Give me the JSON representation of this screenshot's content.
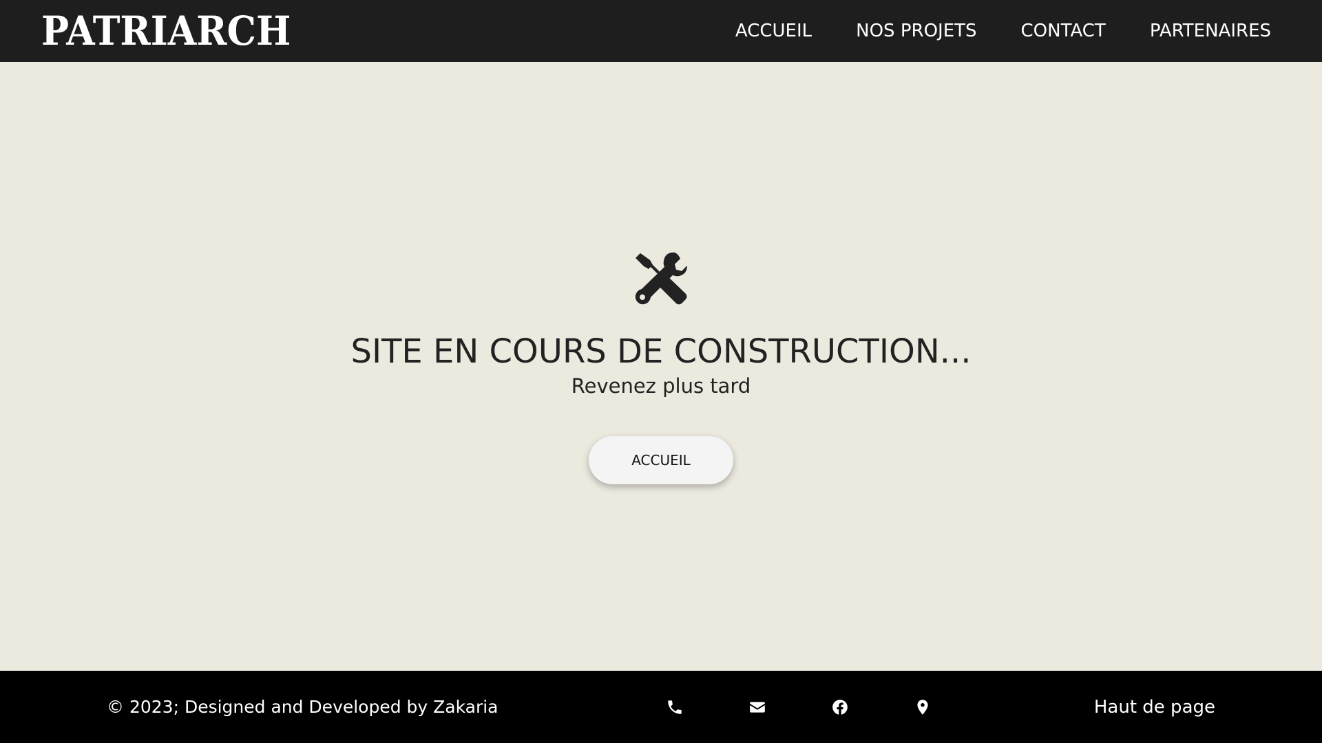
{
  "header": {
    "brand": "PATRIARCH",
    "nav": [
      {
        "label": "ACCUEIL"
      },
      {
        "label": "NOS PROJETS"
      },
      {
        "label": "CONTACT"
      },
      {
        "label": "PARTENAIRES"
      }
    ]
  },
  "main": {
    "icon": "tools-icon",
    "title": "SITE EN COURS DE CONSTRUCTION...",
    "subtitle": "Revenez plus tard",
    "button_label": "ACCUEIL"
  },
  "footer": {
    "copyright": "© 2023; Designed and Developed by Zakaria",
    "icons": [
      "phone-icon",
      "envelope-icon",
      "facebook-icon",
      "map-marker-icon"
    ],
    "back_to_top": "Haut de page"
  },
  "colors": {
    "header_bg": "#1e1e1e",
    "page_bg": "#eceadf",
    "footer_bg": "#000000",
    "text_dark": "#222222",
    "button_bg": "#f4f4f4"
  }
}
